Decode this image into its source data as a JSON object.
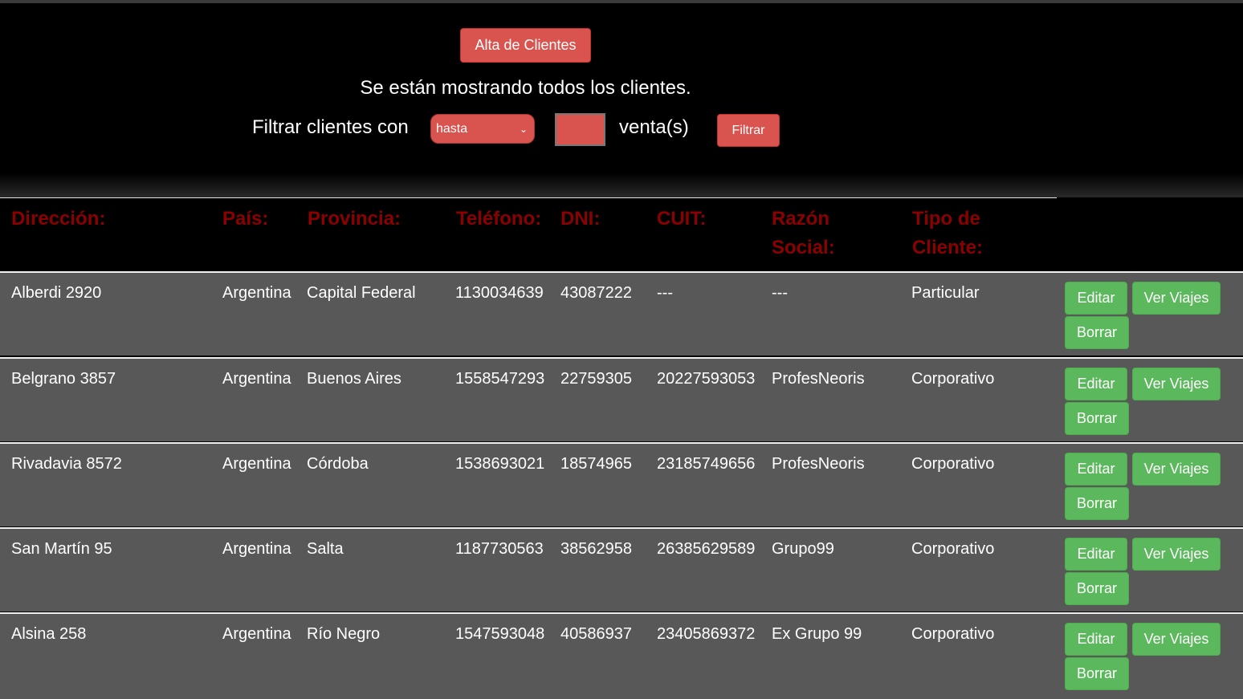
{
  "header": {
    "alta_button": "Alta de Clientes",
    "status_text": "Se están mostrando todos los clientes.",
    "filter_label": "Filtrar clientes con",
    "filter_select_value": "hasta",
    "filter_input_value": "",
    "ventas_label": "venta(s)",
    "filtrar_button": "Filtrar"
  },
  "table": {
    "headers": [
      {
        "line1": "Dirección:",
        "line2": ""
      },
      {
        "line1": "País:",
        "line2": ""
      },
      {
        "line1": "Provincia:",
        "line2": ""
      },
      {
        "line1": "Teléfono:",
        "line2": ""
      },
      {
        "line1": "DNI:",
        "line2": ""
      },
      {
        "line1": "CUIT:",
        "line2": ""
      },
      {
        "line1": "Razón",
        "line2": "Social:"
      },
      {
        "line1": "Tipo de",
        "line2": "Cliente:"
      }
    ],
    "rows": [
      {
        "direccion": "Alberdi 2920",
        "pais": "Argentina",
        "provincia": "Capital Federal",
        "telefono": "1130034639",
        "dni": "43087222",
        "cuit": "---",
        "razon": "---",
        "tipo": "Particular"
      },
      {
        "direccion": "Belgrano 3857",
        "pais": "Argentina",
        "provincia": "Buenos Aires",
        "telefono": "1558547293",
        "dni": "22759305",
        "cuit": "20227593053",
        "razon": "ProfesNeoris",
        "tipo": "Corporativo"
      },
      {
        "direccion": "Rivadavia 8572",
        "pais": "Argentina",
        "provincia": "Córdoba",
        "telefono": "1538693021",
        "dni": "18574965",
        "cuit": "23185749656",
        "razon": "ProfesNeoris",
        "tipo": "Corporativo"
      },
      {
        "direccion": "San Martín 95",
        "pais": "Argentina",
        "provincia": "Salta",
        "telefono": "1187730563",
        "dni": "38562958",
        "cuit": "26385629589",
        "razon": "Grupo99",
        "tipo": "Corporativo"
      },
      {
        "direccion": "Alsina 258",
        "pais": "Argentina",
        "provincia": "Río Negro",
        "telefono": "1547593048",
        "dni": "40586937",
        "cuit": "23405869372",
        "razon": "Ex Grupo 99",
        "tipo": "Corporativo"
      }
    ],
    "actions": {
      "edit": "Editar",
      "trips": "Ver Viajes",
      "delete": "Borrar"
    }
  },
  "colors": {
    "red": "#d9534f",
    "green": "#5cb85c",
    "header_text": "#8b0000",
    "row_bg": "#585858"
  }
}
